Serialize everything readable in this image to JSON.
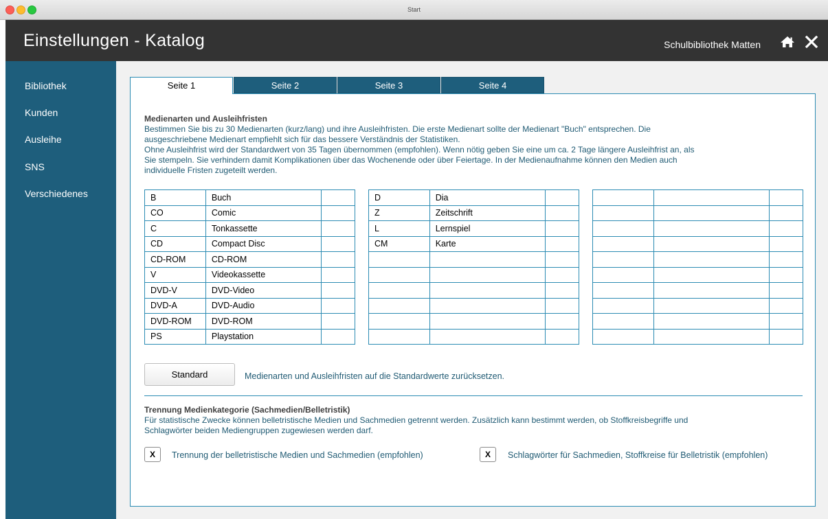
{
  "window": {
    "title": "Start"
  },
  "header": {
    "title": "Einstellungen - Katalog",
    "library": "Schulbibliothek Matten"
  },
  "sidebar": {
    "items": [
      {
        "label": "Bibliothek"
      },
      {
        "label": "Kunden"
      },
      {
        "label": "Ausleihe"
      },
      {
        "label": "SNS"
      },
      {
        "label": "Verschiedenes"
      }
    ]
  },
  "tabs": [
    {
      "label": "Seite 1",
      "active": true
    },
    {
      "label": "Seite 2",
      "active": false
    },
    {
      "label": "Seite 3",
      "active": false
    },
    {
      "label": "Seite 4",
      "active": false
    }
  ],
  "section1": {
    "title": "Medienarten und Ausleihfristen",
    "lines": [
      "Bestimmen Sie bis zu 30 Medienarten (kurz/lang) und ihre Ausleihfristen. Die erste Medienart sollte der Medienart \"Buch\" entsprechen. Die",
      "ausgeschriebene Medienart empfiehlt sich für das bessere Verständnis der Statistiken.",
      "Ohne Ausleihfrist wird der Standardwert von 35 Tagen übernommen (empfohlen). Wenn nötig geben Sie eine um ca. 2 Tage längere Ausleihfrist an, als",
      "Sie stempeln. Sie verhindern damit Komplikationen über das Wochenende oder über Feiertage. In der Medienaufnahme können den Medien auch",
      "individuelle Fristen zugeteilt werden."
    ]
  },
  "media_tables": [
    {
      "rows": [
        [
          "B",
          "Buch",
          ""
        ],
        [
          "CO",
          "Comic",
          ""
        ],
        [
          "C",
          "Tonkassette",
          ""
        ],
        [
          "CD",
          "Compact Disc",
          ""
        ],
        [
          "CD-ROM",
          "CD-ROM",
          ""
        ],
        [
          "V",
          "Videokassette",
          ""
        ],
        [
          "DVD-V",
          "DVD-Video",
          ""
        ],
        [
          "DVD-A",
          "DVD-Audio",
          ""
        ],
        [
          "DVD-ROM",
          "DVD-ROM",
          ""
        ],
        [
          "PS",
          "Playstation",
          ""
        ]
      ]
    },
    {
      "rows": [
        [
          "D",
          "Dia",
          ""
        ],
        [
          "Z",
          "Zeitschrift",
          ""
        ],
        [
          "L",
          "Lernspiel",
          ""
        ],
        [
          "CM",
          "Karte",
          ""
        ],
        [
          "",
          "",
          ""
        ],
        [
          "",
          "",
          ""
        ],
        [
          "",
          "",
          ""
        ],
        [
          "",
          "",
          ""
        ],
        [
          "",
          "",
          ""
        ],
        [
          "",
          "",
          ""
        ]
      ]
    },
    {
      "rows": [
        [
          "",
          "",
          ""
        ],
        [
          "",
          "",
          ""
        ],
        [
          "",
          "",
          ""
        ],
        [
          "",
          "",
          ""
        ],
        [
          "",
          "",
          ""
        ],
        [
          "",
          "",
          ""
        ],
        [
          "",
          "",
          ""
        ],
        [
          "",
          "",
          ""
        ],
        [
          "",
          "",
          ""
        ],
        [
          "",
          "",
          ""
        ]
      ]
    }
  ],
  "standard": {
    "button_label": "Standard",
    "description": "Medienarten und Ausleihfristen auf die Standardwerte zurücksetzen."
  },
  "section2": {
    "title": "Trennung Medienkategorie (Sachmedien/Belletristik)",
    "lines": [
      "Für statistische Zwecke können belletristische Medien und Sachmedien getrennt werden. Zusätzlich kann bestimmt werden, ob Stoffkreisbegriffe und",
      "Schlagwörter beiden Mediengruppen zugewiesen werden darf."
    ]
  },
  "checkboxes": [
    {
      "mark": "X",
      "label": "Trennung der belletristische Medien und Sachmedien (empfohlen)"
    },
    {
      "mark": "X",
      "label": "Schlagwörter für Sachmedien, Stoffkreise für Belletristik (empfohlen)"
    }
  ],
  "colors": {
    "header": "#333333",
    "sidebar": "#1e5e7c",
    "accent": "#2b8bb3",
    "text_blue": "#1f5a73"
  },
  "icons": {
    "home": "home-icon",
    "close": "close-icon"
  }
}
